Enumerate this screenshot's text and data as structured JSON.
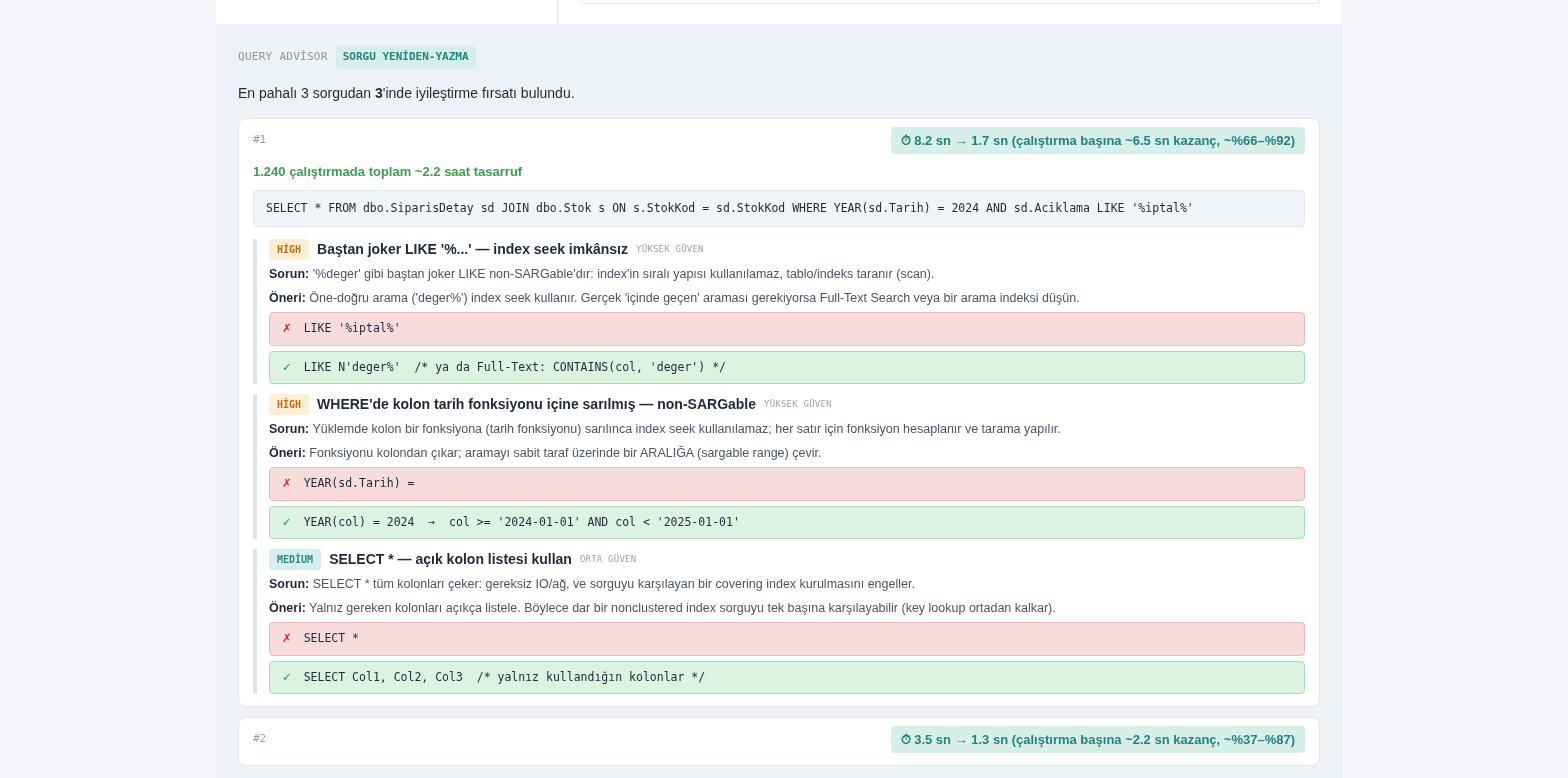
{
  "section": {
    "label": "QUERY ADVİSOR",
    "tag": "SORGU YENİDEN-YAZMA"
  },
  "summary": "En pahalı 3 sorgudan **3**'inde iyileştirme fırsatı bulundu.",
  "queries": [
    {
      "rank": "#1",
      "gain": "⏱ 8.2 sn → 1.7 sn (çalıştırma başına ~6.5 sn kazanç, ~%66–%92)",
      "total": "1.240 çalıştırmada toplam ~2.2 saat tasarruf",
      "sql": "SELECT * FROM dbo.SiparisDetay sd JOIN dbo.Stok s ON s.StokKod = sd.StokKod WHERE YEAR(sd.Tarih) = 2024 AND sd.Aciklama LIKE '%iptal%'",
      "findings": [
        {
          "kind": "high",
          "badge": "HİGH",
          "title": "Baştan joker LIKE '%...' — index seek imkânsız",
          "confidence": "YÜKSEK GÜVEN",
          "problem_label": "Sorun:",
          "problem": "'%deger' gibi baştan joker LIKE non-SARGable'dır: index'in sıralı yapısı kullanılamaz, tablo/indeks taranır (scan).",
          "advice_label": "Öneri:",
          "advice": "Öne-doğru arama ('deger%') index seek kullanır. Gerçek 'içinde geçen' araması gerekiyorsa Full-Text Search veya bir arama indeksi düşün.",
          "bad_mark": "✗",
          "bad": "LIKE '%iptal%'",
          "good_mark": "✓",
          "good": "LIKE N'deger%'  /* ya da Full-Text: CONTAINS(col, 'deger') */"
        },
        {
          "kind": "high",
          "badge": "HİGH",
          "title": "WHERE'de kolon tarih fonksiyonu içine sarılmış — non-SARGable",
          "confidence": "YÜKSEK GÜVEN",
          "problem_label": "Sorun:",
          "problem": "Yüklemde kolon bir fonksiyona (tarih fonksiyonu) sarılınca index seek kullanılamaz; her satır için fonksiyon hesaplanır ve tarama yapılır.",
          "advice_label": "Öneri:",
          "advice": "Fonksiyonu kolondan çıkar; aramayı sabit taraf üzerinde bir ARALIĞA (sargable range) çevir.",
          "bad_mark": "✗",
          "bad": "YEAR(sd.Tarih) =",
          "good_mark": "✓",
          "good": "YEAR(col) = 2024  →  col >= '2024-01-01' AND col < '2025-01-01'"
        },
        {
          "kind": "medium",
          "badge": "MEDİUM",
          "title": "SELECT * — açık kolon listesi kullan",
          "confidence": "ORTA GÜVEN",
          "problem_label": "Sorun:",
          "problem": "SELECT * tüm kolonları çeker: gereksiz IO/ağ, ve sorguyu karşılayan bir covering index kurulmasını engeller.",
          "advice_label": "Öneri:",
          "advice": "Yalnız gereken kolonları açıkça listele. Böylece dar bir nonclustered index sorguyu tek başına karşılayabilir (key lookup ortadan kalkar).",
          "bad_mark": "✗",
          "bad": "SELECT *",
          "good_mark": "✓",
          "good": "SELECT Col1, Col2, Col3  /* yalnız kullandığın kolonlar */"
        }
      ]
    },
    {
      "rank": "#2",
      "gain": "⏱ 3.5 sn → 1.3 sn (çalıştırma başına ~2.2 sn kazanç, ~%37–%87)"
    }
  ]
}
